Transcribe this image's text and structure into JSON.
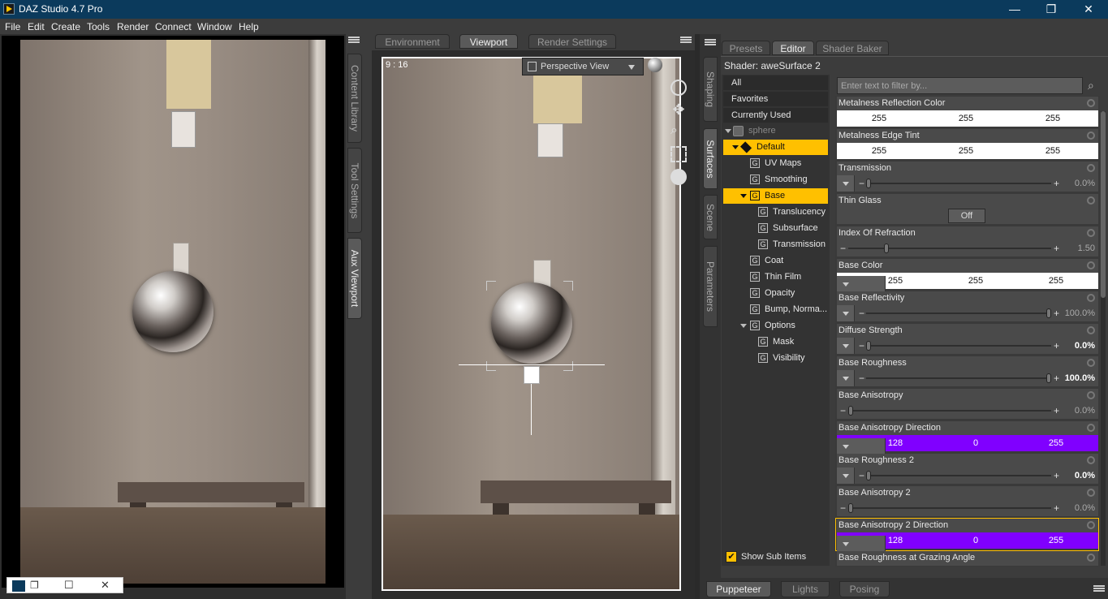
{
  "window": {
    "title": "DAZ Studio 4.7 Pro"
  },
  "menu": [
    "File",
    "Edit",
    "Create",
    "Tools",
    "Render",
    "Connect",
    "Window",
    "Help"
  ],
  "left_panel": {
    "vertical_tabs": [
      "Content Library",
      "Tool Settings",
      "Aux Viewport"
    ]
  },
  "viewport": {
    "tabs": [
      "Environment",
      "Viewport",
      "Render Settings"
    ],
    "aspect_label": "9 : 16",
    "view_select": "Perspective View"
  },
  "right_vertical_tabs": [
    "Shaping",
    "Surfaces",
    "Scene",
    "Parameters"
  ],
  "surfaces": {
    "tabs": [
      "Presets",
      "Editor",
      "Shader Baker"
    ],
    "shader_label": "Shader: aweSurface 2",
    "filters": [
      "All",
      "Favorites",
      "Currently Used"
    ],
    "filter_placeholder": "Enter text to filter by...",
    "tree": [
      {
        "label": "sphere"
      },
      {
        "label": "Default"
      },
      {
        "label": "UV Maps"
      },
      {
        "label": "Smoothing"
      },
      {
        "label": "Base"
      },
      {
        "label": "Translucency"
      },
      {
        "label": "Subsurface"
      },
      {
        "label": "Transmission"
      },
      {
        "label": "Coat"
      },
      {
        "label": "Thin Film"
      },
      {
        "label": "Opacity"
      },
      {
        "label": "Bump, Norma..."
      },
      {
        "label": "Options"
      },
      {
        "label": "Mask"
      },
      {
        "label": "Visibility"
      }
    ],
    "show_sub_items": "Show Sub Items",
    "properties": [
      {
        "name": "Metalness Reflection Color",
        "kind": "color",
        "values": [
          "255",
          "255",
          "255"
        ]
      },
      {
        "name": "Metalness Edge Tint",
        "kind": "color",
        "values": [
          "255",
          "255",
          "255"
        ]
      },
      {
        "name": "Transmission",
        "kind": "slider",
        "value": "0.0%",
        "fraction": 0
      },
      {
        "name": "Thin Glass",
        "kind": "toggle",
        "value": "Off"
      },
      {
        "name": "Index Of Refraction",
        "kind": "slider",
        "value": "1.50",
        "fraction": 0.18
      },
      {
        "name": "Base Color",
        "kind": "color",
        "values": [
          "255",
          "255",
          "255"
        ]
      },
      {
        "name": "Base Reflectivity",
        "kind": "slider",
        "value": "100.0%",
        "fraction": 1
      },
      {
        "name": "Diffuse Strength",
        "kind": "slider",
        "value": "0.0%",
        "fraction": 0
      },
      {
        "name": "Base Roughness",
        "kind": "slider",
        "value": "100.0%",
        "fraction": 1
      },
      {
        "name": "Base Anisotropy",
        "kind": "slider",
        "value": "0.0%",
        "fraction": 0
      },
      {
        "name": "Base Anisotropy Direction",
        "kind": "color",
        "values": [
          "128",
          "0",
          "255"
        ]
      },
      {
        "name": "Base Roughness 2",
        "kind": "slider",
        "value": "0.0%",
        "fraction": 0
      },
      {
        "name": "Base Anisotropy 2",
        "kind": "slider",
        "value": "0.0%",
        "fraction": 0
      },
      {
        "name": "Base Anisotropy 2 Direction",
        "kind": "color",
        "values": [
          "128",
          "0",
          "255"
        ]
      },
      {
        "name": "Base Roughness at Grazing Angle",
        "kind": "slider",
        "value": "",
        "fraction": 0
      }
    ]
  },
  "bottom_tabs": [
    "Puppeteer",
    "Lights",
    "Posing"
  ],
  "colors": {
    "accent": "#ffc000",
    "purple": "#8000ff",
    "titlebar": "#0b3a5c"
  }
}
